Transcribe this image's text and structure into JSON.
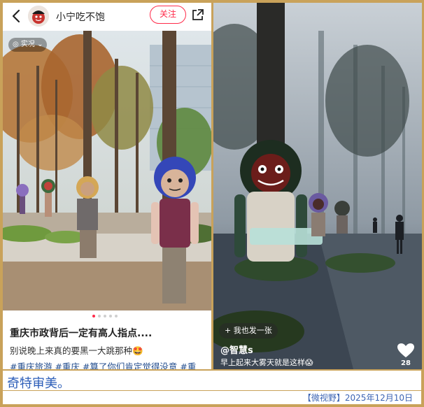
{
  "left_post": {
    "username": "小宁吃不饱",
    "follow_label": "关注",
    "live_tag": "实况",
    "carousel": {
      "count": 5,
      "active_index": 0
    },
    "title": "重庆市政背后一定有高人指点....",
    "body": "别说晚上来真的要黑一大跳那种🤩",
    "tags": "#重庆旅游 #重庆 #算了你们肯定觉得没意 #重"
  },
  "right_post": {
    "me_too_label": "+ 我也发一张",
    "handle": "@智慧s",
    "caption": "早上起来大雾天就是这样😱",
    "likes": "28"
  },
  "footer": {
    "caption": "奇特审美。",
    "credit": "【微视野】2025年12月10日"
  },
  "colors": {
    "accent": "#ff2b4a",
    "frame": "#c9a25a",
    "tag_blue": "#1f4a8c",
    "caption_blue": "#2b5db8"
  }
}
